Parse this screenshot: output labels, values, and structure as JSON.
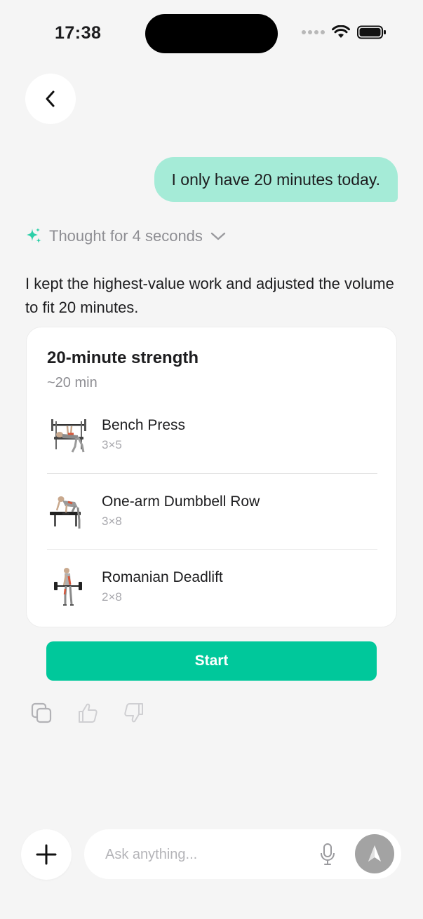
{
  "status_bar": {
    "time": "17:38"
  },
  "chat": {
    "user_message": "I only have 20 minutes today.",
    "thought_label": "Thought for 4 seconds",
    "reply_text": "I kept the highest-value work and adjusted the volume to fit 20 minutes."
  },
  "workout_card": {
    "title": "20-minute strength",
    "duration": "~20 min",
    "exercises": [
      {
        "name": "Bench Press",
        "sets": "3×5",
        "icon": "bench-press-illustration"
      },
      {
        "name": "One-arm Dumbbell Row",
        "sets": "3×8",
        "icon": "dumbbell-row-illustration"
      },
      {
        "name": "Romanian Deadlift",
        "sets": "2×8",
        "icon": "romanian-deadlift-illustration"
      }
    ],
    "start_label": "Start"
  },
  "composer": {
    "placeholder": "Ask anything..."
  },
  "colors": {
    "accent": "#00c89b",
    "user_bubble": "#a5ebd7",
    "sparkle": "#2ccfa8",
    "background": "#f5f5f5",
    "send_button": "#a3a3a3"
  }
}
